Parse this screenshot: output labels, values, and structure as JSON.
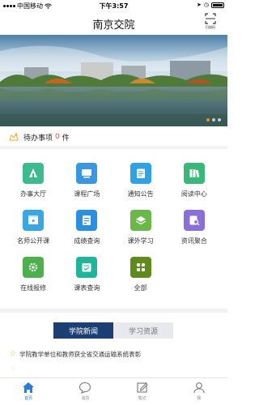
{
  "status_bar": {
    "carrier": "中国移动",
    "time": "下午3:57",
    "battery_icon": "battery-icon",
    "wifi_icon": "wifi-icon"
  },
  "header": {
    "title": "南京交院",
    "scan_label": "扫描码"
  },
  "banner": {
    "pages": 3,
    "active_page": 1
  },
  "todo": {
    "label": "待办事项",
    "count": "0",
    "unit": "件"
  },
  "grid": [
    {
      "label": "办事大厅",
      "icon": "hall-icon",
      "color": "#3dbb8c"
    },
    {
      "label": "课程广场",
      "icon": "course-icon",
      "color": "#3a96e0"
    },
    {
      "label": "通知公告",
      "icon": "notice-icon",
      "color": "#2fa2e6"
    },
    {
      "label": "阅读中心",
      "icon": "books-icon",
      "color": "#39b87a"
    },
    {
      "label": "名师公开课",
      "icon": "video-icon",
      "color": "#3aa6e2"
    },
    {
      "label": "成绩查询",
      "icon": "score-icon",
      "color": "#2b8fe0"
    },
    {
      "label": "课外学习",
      "icon": "layers-icon",
      "color": "#6ab84a"
    },
    {
      "label": "资讯聚合",
      "icon": "search-doc-icon",
      "color": "#8b6fd9"
    },
    {
      "label": "在线报修",
      "icon": "gear-icon",
      "color": "#4db04d"
    },
    {
      "label": "课表查询",
      "icon": "schedule-icon",
      "color": "#20b59a"
    },
    {
      "label": "全部",
      "icon": "apps-icon",
      "color": "#5e8a1e"
    }
  ],
  "tabs": [
    {
      "label": "学院新闻",
      "active": true
    },
    {
      "label": "学习资源",
      "active": false
    }
  ],
  "news": [
    {
      "title": "学院教学单位和教师获全省交通运输系统表彰"
    },
    {
      "title": ""
    }
  ],
  "bottom_nav": [
    {
      "label": "首页",
      "icon": "home-icon",
      "active": true
    },
    {
      "label": "消息",
      "icon": "chat-icon",
      "active": false
    },
    {
      "label": "笔记",
      "icon": "note-icon",
      "active": false
    },
    {
      "label": "我",
      "icon": "user-icon",
      "active": false
    }
  ]
}
